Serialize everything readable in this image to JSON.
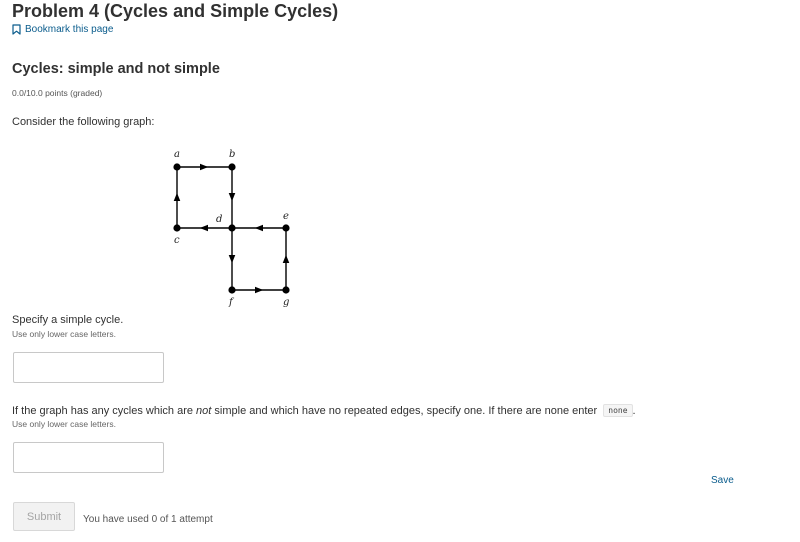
{
  "header": {
    "title": "Problem 4 (Cycles and Simple Cycles)",
    "bookmark_label": "Bookmark this page"
  },
  "problem": {
    "section_title": "Cycles: simple and not simple",
    "points": "0.0/10.0 points (graded)",
    "prompt": "Consider the following graph:",
    "graph": {
      "vertices": [
        "a",
        "b",
        "c",
        "d",
        "e",
        "f",
        "g"
      ],
      "edges": [
        [
          "a",
          "b"
        ],
        [
          "b",
          "d"
        ],
        [
          "c",
          "a"
        ],
        [
          "d",
          "c"
        ],
        [
          "e",
          "d"
        ],
        [
          "d",
          "f"
        ],
        [
          "f",
          "g"
        ],
        [
          "g",
          "e"
        ]
      ]
    },
    "question1": {
      "label": "Specify a simple cycle.",
      "hint": "Use only lower case letters.",
      "value": "",
      "placeholder": ""
    },
    "question2": {
      "label_before": "If the graph has any cycles which are ",
      "label_em": "not",
      "label_after": " simple and which have no repeated edges, specify one. If there are none enter ",
      "code": "none",
      "label_end": ".",
      "hint": "Use only lower case letters.",
      "value": "",
      "placeholder": ""
    }
  },
  "actions": {
    "save_label": "Save",
    "submit_label": "Submit",
    "attempts_text": "You have used 0 of 1 attempt"
  },
  "colors": {
    "link": "#0a5c8c",
    "text": "#313131",
    "submit_disabled_text": "#a5a5a5"
  }
}
